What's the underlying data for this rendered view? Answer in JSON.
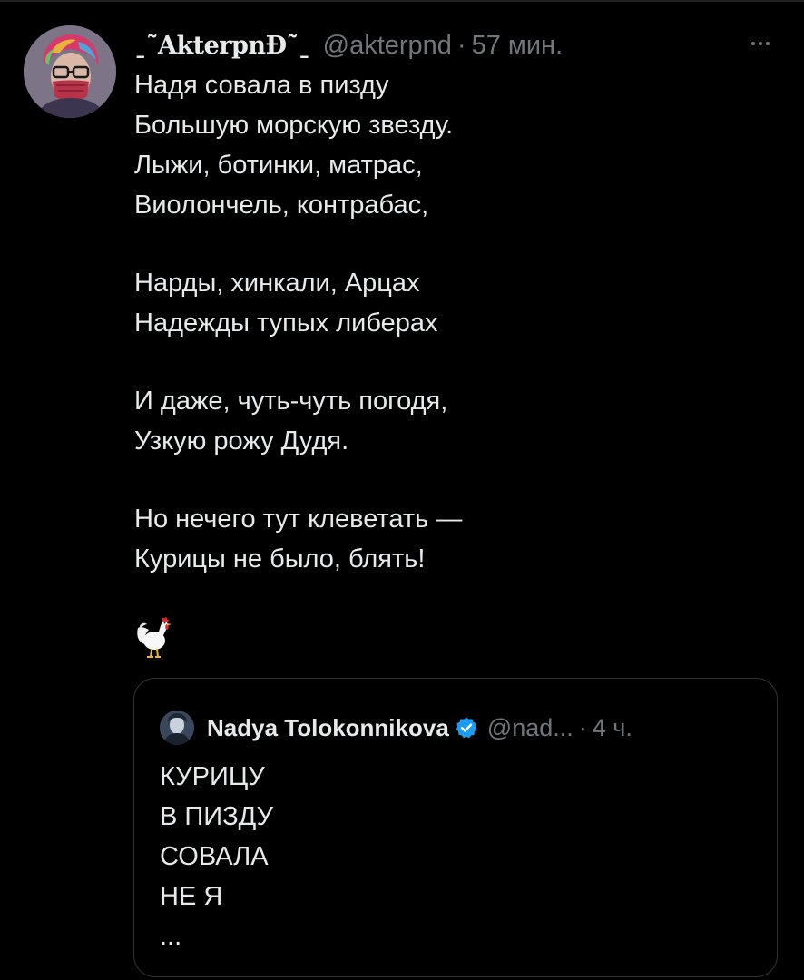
{
  "tweet": {
    "author": {
      "display_name": "ˍ˜AkterpnĐ˜ˍ",
      "handle": "@akterpnd",
      "avatar_icon": "user-avatar-icon"
    },
    "separator": "·",
    "time": "57 мин.",
    "more_icon": "more-horizontal-icon",
    "lines": [
      "Надя совала в пизду",
      "Большую морскую звезду.",
      "Лыжи, ботинки, матрас,",
      "Виолончель, контрабас,",
      "",
      "Нарды, хинкали, Арцах",
      "Надежды тупых либерах",
      "",
      "И даже, чуть-чуть погодя,",
      "Узкую рожу Дудя.",
      "",
      "Но нечего тут клеветать —",
      "Курицы не было, блять!"
    ],
    "emoji": "rooster-emoji"
  },
  "quoted_tweet": {
    "author": {
      "display_name": "Nadya Tolokonnikova",
      "handle": "@nad...",
      "verified": true,
      "avatar_icon": "user-avatar-icon"
    },
    "separator": "·",
    "time": "4 ч.",
    "lines": [
      "КУРИЦУ",
      "В ПИЗДУ",
      "СОВАЛА",
      "НЕ Я",
      "..."
    ]
  },
  "colors": {
    "background": "#000000",
    "text_primary": "#e7e9ea",
    "text_secondary": "#71767b",
    "border": "#2f3336",
    "verified_blue": "#1d9bf0"
  }
}
